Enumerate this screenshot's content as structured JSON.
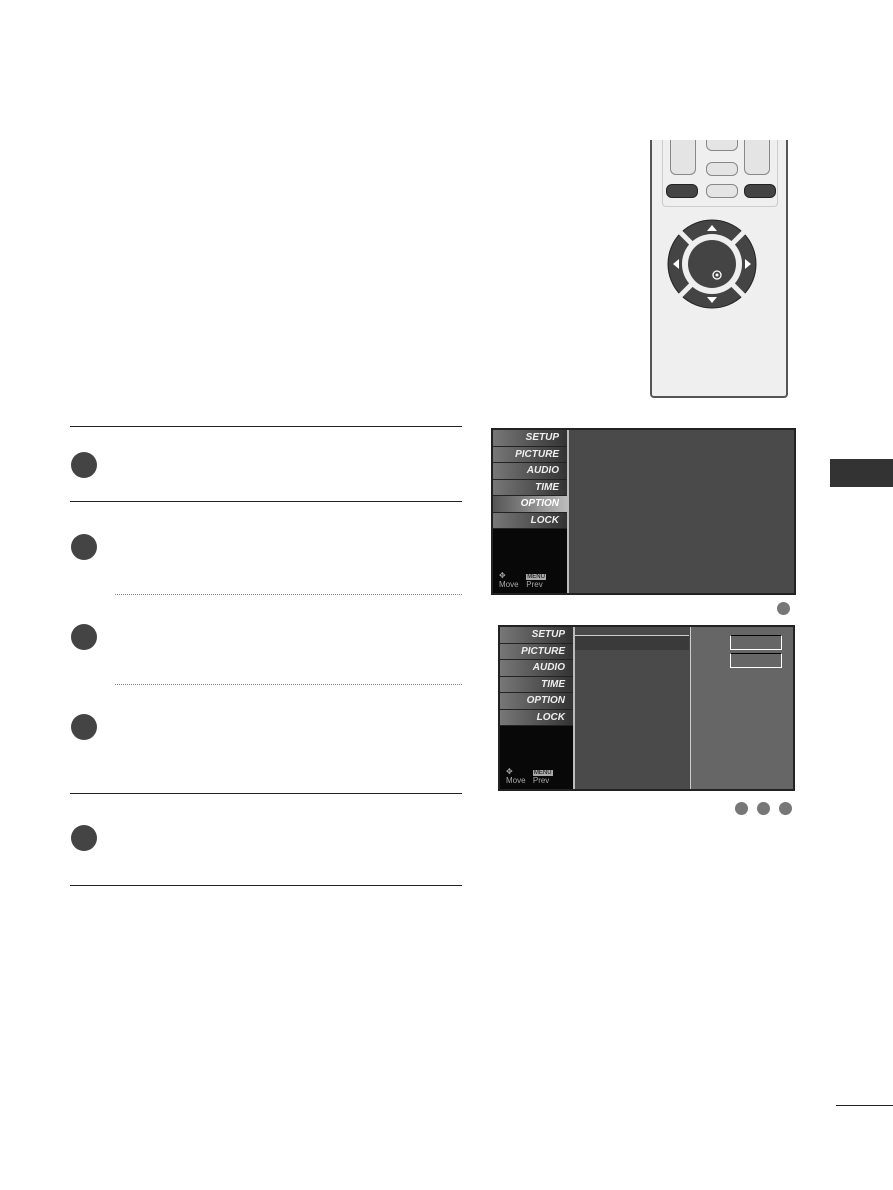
{
  "menu1": {
    "items": [
      "SETUP",
      "PICTURE",
      "AUDIO",
      "TIME",
      "OPTION",
      "LOCK"
    ],
    "selected": 4,
    "move_label": "Move",
    "menu_key": "MENU",
    "prev_label": "Prev"
  },
  "menu2": {
    "items": [
      "SETUP",
      "PICTURE",
      "AUDIO",
      "TIME",
      "OPTION",
      "LOCK"
    ],
    "move_label": "Move",
    "menu_key": "MENU",
    "prev_label": "Prev"
  },
  "remote": {
    "icons": [
      "up-arrow-icon",
      "down-arrow-icon",
      "left-arrow-icon",
      "right-arrow-icon",
      "enter-icon"
    ]
  }
}
